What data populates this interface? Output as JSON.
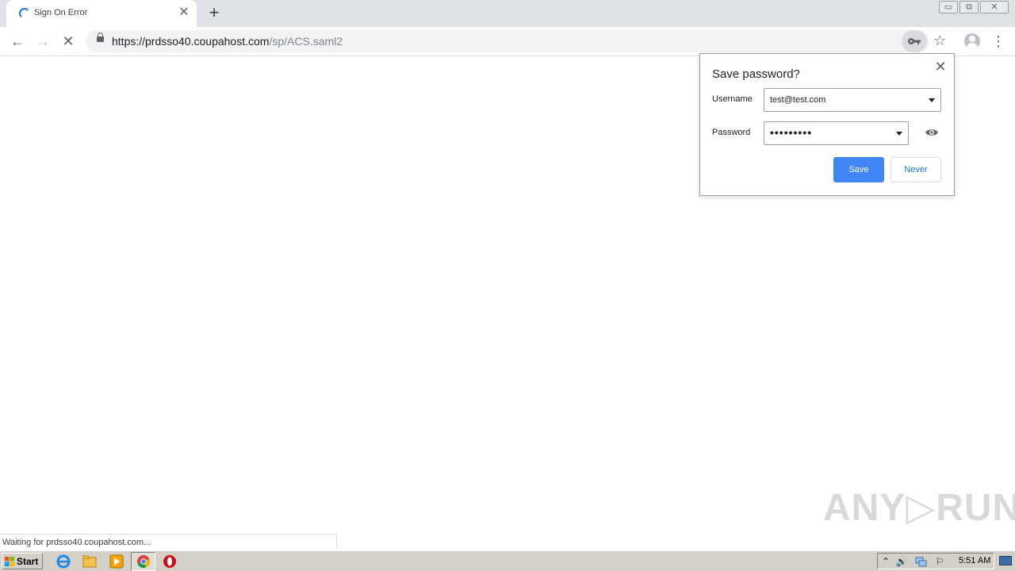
{
  "browser": {
    "tab": {
      "title": "Sign On Error",
      "close": "✕"
    },
    "newtab": "+",
    "window_controls": {
      "minimize": "▭",
      "restore": "⧉",
      "close": "✕"
    },
    "nav": {
      "back": "←",
      "forward": "→",
      "stop": "✕"
    },
    "url": {
      "host": "https://prdsso40.coupahost.com",
      "path": "/sp/ACS.saml2"
    },
    "star": "☆",
    "menu": "⋮",
    "status": "Waiting for prdsso40.coupahost.com..."
  },
  "password_bubble": {
    "title": "Save password?",
    "close": "✕",
    "username_label": "Username",
    "username_value": "test@test.com",
    "password_label": "Password",
    "password_value": "•••••••••",
    "save_label": "Save",
    "never_label": "Never"
  },
  "watermark": "ANY▷RUN",
  "taskbar": {
    "start_label": "Start",
    "clock": "5:51 AM",
    "tray": {
      "expand": "⌃",
      "volume": "🔊",
      "flag": "⚐"
    }
  },
  "colors": {
    "accent": "#4285f4",
    "link": "#1a73e8",
    "tabstrip": "#dee1e6",
    "taskbar": "#d4d0c8"
  },
  "icons": [
    "spinner-icon",
    "close-icon",
    "plus-icon",
    "back-icon",
    "forward-icon",
    "stop-icon",
    "lock-icon",
    "key-icon",
    "star-icon",
    "profile-icon",
    "menu-icon",
    "chevron-down-icon",
    "eye-icon",
    "windows-logo-icon",
    "ie-icon",
    "folder-icon",
    "media-player-icon",
    "chrome-icon",
    "opera-icon",
    "volume-icon",
    "network-icon",
    "flag-icon"
  ]
}
